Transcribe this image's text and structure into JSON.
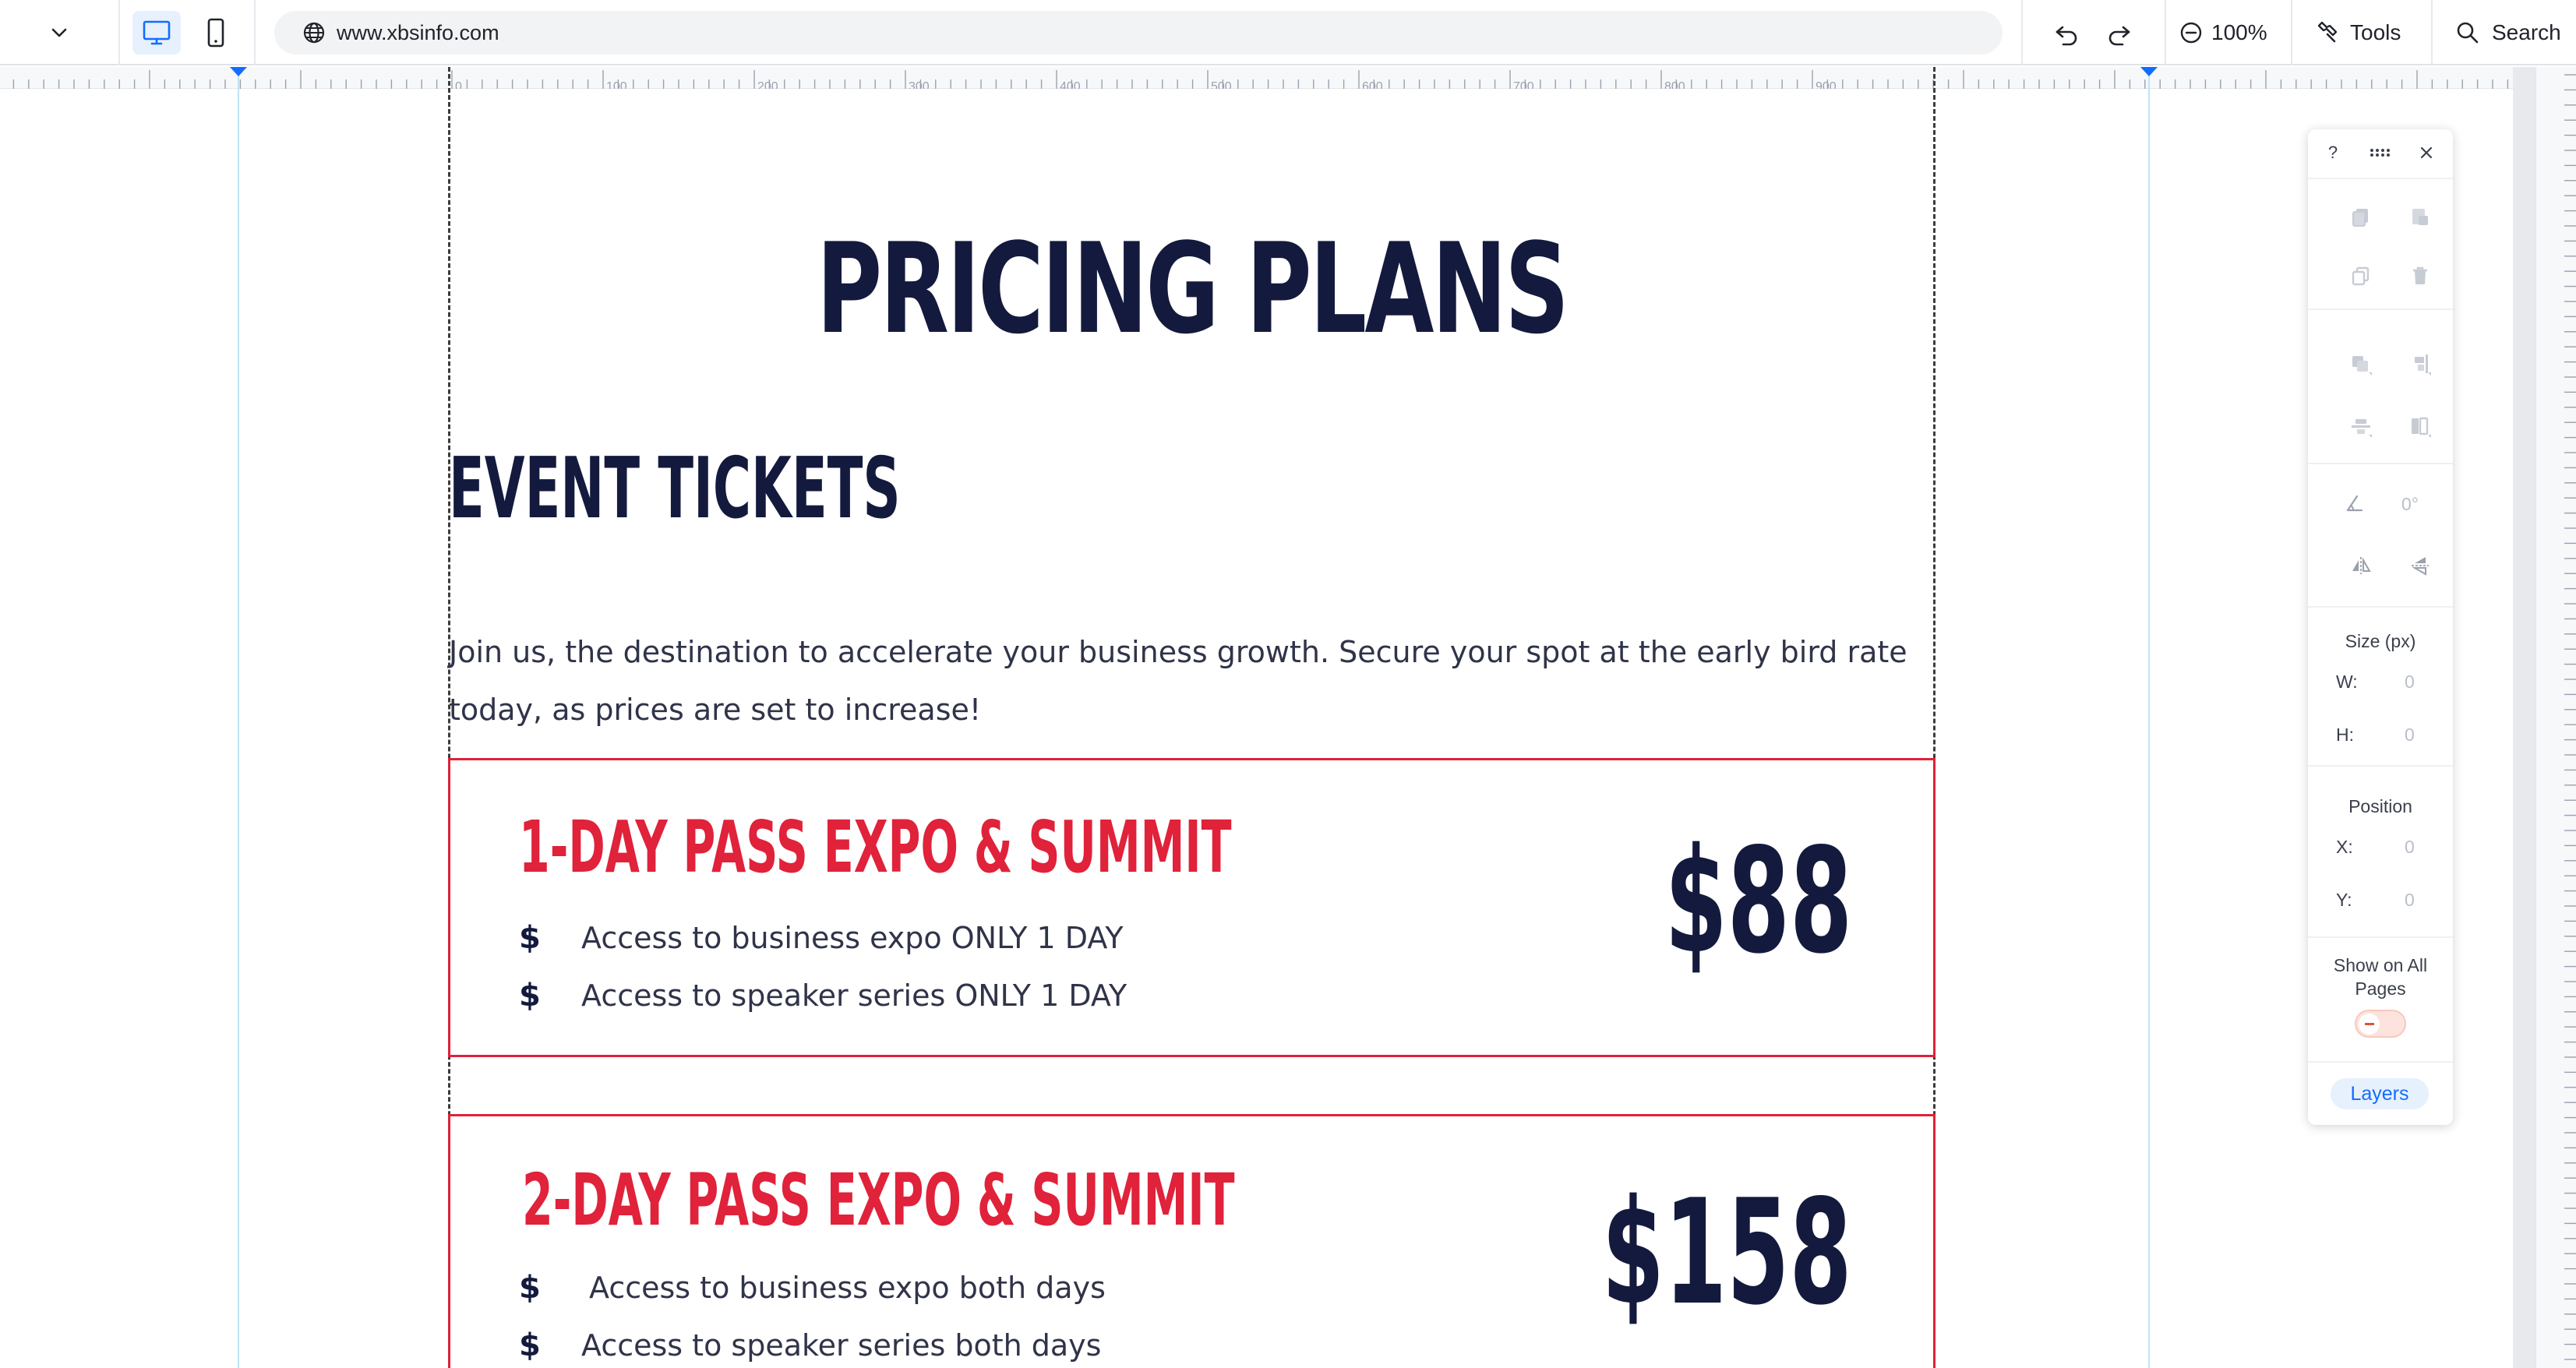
{
  "toolbar": {
    "url": "www.xbsinfo.com",
    "zoom": "100%",
    "tools_label": "Tools",
    "search_label": "Search"
  },
  "ruler": {
    "ticks": [
      "0",
      "100",
      "200",
      "300",
      "400",
      "500",
      "600",
      "700",
      "800",
      "900"
    ]
  },
  "page": {
    "hero_title": "PRICING PLANS",
    "section_title": "EVENT TICKETS",
    "intro_line1": "Join us, the destination to accelerate your business growth. Secure your spot at the early bird rate",
    "intro_line2": "today, as prices are set to increase!",
    "cards": [
      {
        "title": "1-DAY PASS EXPO & SUMMIT",
        "price": "$88",
        "features": [
          "Access to business expo ONLY 1 DAY",
          "Access to speaker series ONLY 1 DAY"
        ]
      },
      {
        "title": "2-DAY PASS EXPO & SUMMIT",
        "price": "$158",
        "features": [
          "Access to business expo both days",
          "Access to speaker series both days"
        ]
      }
    ],
    "bullet_symbol": "$"
  },
  "panel": {
    "help": "?",
    "rotation": "0°",
    "size_label": "Size (px)",
    "w_label": "W:",
    "w_value": "0",
    "h_label": "H:",
    "h_value": "0",
    "position_label": "Position",
    "x_label": "X:",
    "x_value": "0",
    "y_label": "Y:",
    "y_value": "0",
    "show_all_line1": "Show on All",
    "show_all_line2": "Pages",
    "show_all_on": false,
    "layers_label": "Layers"
  },
  "colors": {
    "accent_red": "#e0223a",
    "navy": "#131a3d",
    "link_blue": "#116dff"
  }
}
